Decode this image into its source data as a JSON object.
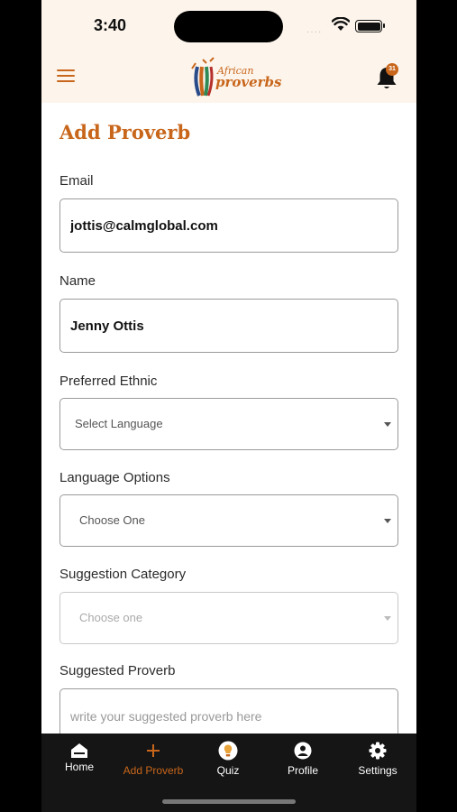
{
  "status_bar": {
    "time": "3:40",
    "signal": "····"
  },
  "header": {
    "logo_line1": "African",
    "logo_line2": "proverbs",
    "notification_count": "31"
  },
  "page": {
    "title": "Add Proverb"
  },
  "form": {
    "email": {
      "label": "Email",
      "value": "jottis@calmglobal.com"
    },
    "name": {
      "label": "Name",
      "value": "Jenny Ottis"
    },
    "preferred_ethnic": {
      "label": "Preferred Ethnic",
      "value": "Select Language"
    },
    "language_options": {
      "label": "Language Options",
      "value": "Choose One"
    },
    "suggestion_category": {
      "label": "Suggestion Category",
      "value": "Choose one"
    },
    "suggested_proverb": {
      "label": "Suggested Proverb",
      "placeholder": "write your suggested proverb here"
    }
  },
  "tabs": [
    {
      "label": "Home",
      "icon": "home-icon"
    },
    {
      "label": "Add Proverb",
      "icon": "plus-icon",
      "active": true
    },
    {
      "label": "Quiz",
      "icon": "quiz-bulb-icon"
    },
    {
      "label": "Profile",
      "icon": "profile-icon"
    },
    {
      "label": "Settings",
      "icon": "gear-icon"
    }
  ],
  "colors": {
    "accent": "#c8661b",
    "header_bg": "#fdf5ec",
    "tabbar_bg": "#151515"
  }
}
